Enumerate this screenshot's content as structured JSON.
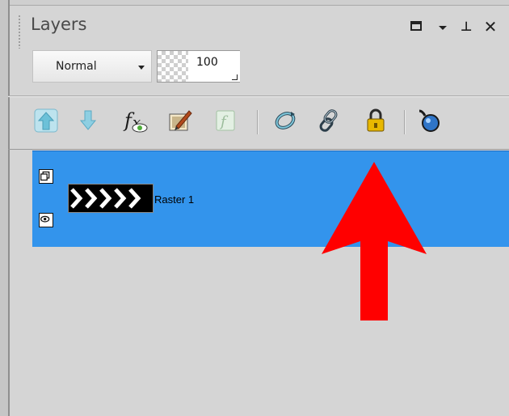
{
  "panel": {
    "title": "Layers"
  },
  "window_buttons": {
    "pin_glyph": "⊥",
    "close_glyph": "✕"
  },
  "blend_mode": {
    "selected": "Normal"
  },
  "opacity": {
    "value": "100"
  },
  "toolbar": {
    "icons": [
      "move-layer-up-icon",
      "move-layer-down-icon",
      "layer-effects-icon",
      "layer-properties-icon",
      "layer-style-disabled-icon",
      "refresh-icon",
      "link-icon",
      "lock-icon",
      "pin-icon"
    ]
  },
  "layers": [
    {
      "name": "Raster 1",
      "selected": true,
      "visible": true
    }
  ],
  "colors": {
    "selection": "#3394ec",
    "annotation_arrow": "#ff0000",
    "lock": "#e8b800"
  }
}
